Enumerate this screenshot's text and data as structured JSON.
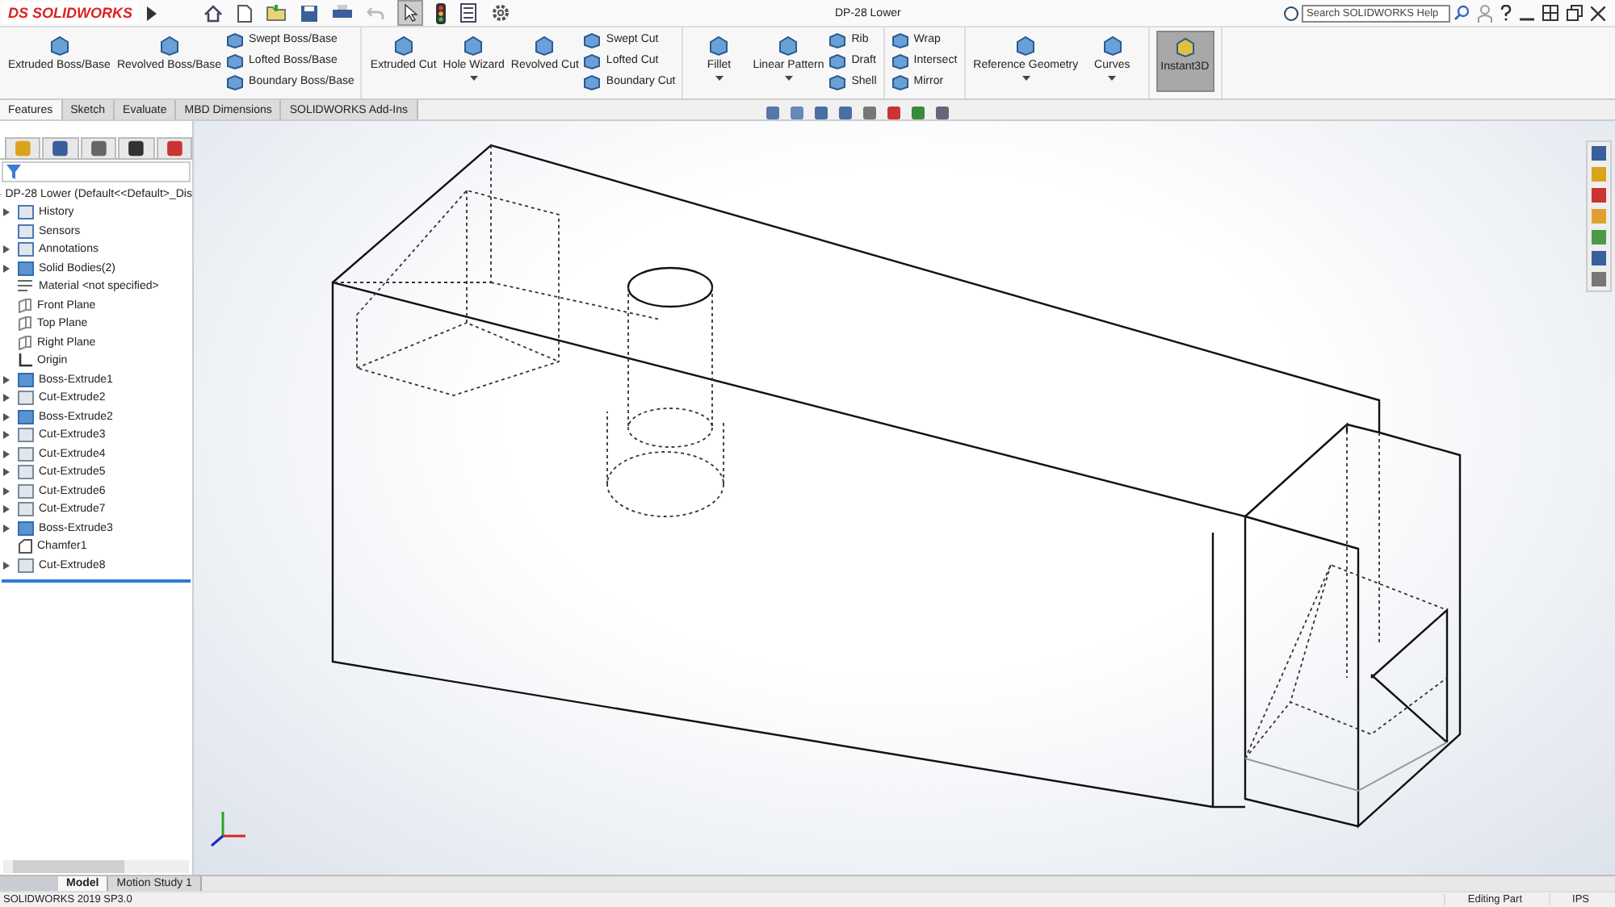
{
  "app": {
    "logo_mark": "DS",
    "logo": "SOLIDWORKS",
    "document_title": "DP-28 Lower",
    "search": {
      "placeholder": "Search SOLIDWORKS Help"
    }
  },
  "ribbon": {
    "groups": [
      {
        "large": [
          {
            "label": "Extruded Boss/Base",
            "dropdown": false,
            "selected": false
          },
          {
            "label": "Revolved Boss/Base",
            "dropdown": false,
            "selected": false
          }
        ],
        "small": [
          "Swept Boss/Base",
          "Lofted Boss/Base",
          "Boundary Boss/Base"
        ]
      },
      {
        "large": [
          {
            "label": "Extruded Cut",
            "dropdown": false,
            "selected": false
          },
          {
            "label": "Hole Wizard",
            "dropdown": true,
            "selected": false
          },
          {
            "label": "Revolved Cut",
            "dropdown": false,
            "selected": false
          }
        ],
        "small": [
          "Swept Cut",
          "Lofted Cut",
          "Boundary Cut"
        ]
      },
      {
        "large": [
          {
            "label": "Fillet",
            "dropdown": true,
            "selected": false
          },
          {
            "label": "Linear Pattern",
            "dropdown": true,
            "selected": false
          }
        ],
        "small": [
          "Rib",
          "Draft",
          "Shell"
        ]
      },
      {
        "small": [
          "Wrap",
          "Intersect",
          "Mirror"
        ]
      },
      {
        "large": [
          {
            "label": "Reference Geometry",
            "dropdown": true,
            "selected": false
          },
          {
            "label": "Curves",
            "dropdown": true,
            "selected": false
          }
        ]
      },
      {
        "large": [
          {
            "label": "Instant3D",
            "dropdown": false,
            "selected": true
          }
        ]
      }
    ]
  },
  "tabs": [
    {
      "label": "Features",
      "selected": true
    },
    {
      "label": "Sketch",
      "selected": false
    },
    {
      "label": "Evaluate",
      "selected": false
    },
    {
      "label": "MBD Dimensions",
      "selected": false
    },
    {
      "label": "SOLIDWORKS Add-Ins",
      "selected": false
    }
  ],
  "feature_tree": {
    "root": "DP-28 Lower  (Default<<Default>_Dis",
    "items": [
      {
        "label": "History",
        "kind": "history",
        "expander": true
      },
      {
        "label": "Sensors",
        "kind": "sensors",
        "expander": false
      },
      {
        "label": "Annotations",
        "kind": "annotations",
        "expander": true
      },
      {
        "label": "Solid Bodies(2)",
        "kind": "bodies",
        "expander": true
      },
      {
        "label": "Material <not specified>",
        "kind": "material",
        "expander": false
      },
      {
        "label": "Front Plane",
        "kind": "plane",
        "expander": false
      },
      {
        "label": "Top Plane",
        "kind": "plane",
        "expander": false
      },
      {
        "label": "Right Plane",
        "kind": "plane",
        "expander": false
      },
      {
        "label": "Origin",
        "kind": "origin",
        "expander": false
      },
      {
        "label": "Boss-Extrude1",
        "kind": "boss",
        "expander": true
      },
      {
        "label": "Cut-Extrude2",
        "kind": "cut",
        "expander": true
      },
      {
        "label": "Boss-Extrude2",
        "kind": "boss",
        "expander": true
      },
      {
        "label": "Cut-Extrude3",
        "kind": "cut",
        "expander": true
      },
      {
        "label": "Cut-Extrude4",
        "kind": "cut",
        "expander": true
      },
      {
        "label": "Cut-Extrude5",
        "kind": "cut",
        "expander": true
      },
      {
        "label": "Cut-Extrude6",
        "kind": "cut",
        "expander": true
      },
      {
        "label": "Cut-Extrude7",
        "kind": "cut",
        "expander": true
      },
      {
        "label": "Boss-Extrude3",
        "kind": "boss",
        "expander": true
      },
      {
        "label": "Chamfer1",
        "kind": "chamfer",
        "expander": false
      },
      {
        "label": "Cut-Extrude8",
        "kind": "cut",
        "expander": true
      }
    ]
  },
  "bottom_tabs": [
    {
      "label": "Model",
      "selected": true
    },
    {
      "label": "Motion Study 1",
      "selected": false
    }
  ],
  "status_bar": {
    "version": "SOLIDWORKS 2019 SP3.0",
    "mode": "Editing Part",
    "units": "IPS"
  }
}
